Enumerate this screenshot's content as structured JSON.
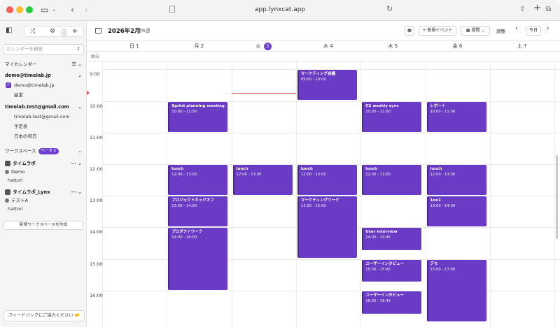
{
  "browser": {
    "url": "app.lynxcat.app"
  },
  "sidebar": {
    "search_placeholder": "カレンダーを検索",
    "my_calendars_label": "マイカレンダー",
    "accounts": [
      {
        "email": "demo@timelab.jp",
        "calendars": [
          "demo@timelab.jp",
          "副業"
        ]
      },
      {
        "email": "timelab.test@gmail.com",
        "calendars": [
          "timelab.test@gmail.com",
          "予定表",
          "日本の祝日"
        ]
      }
    ],
    "workspace_label": "ワークスペース",
    "workspace_badge": "ベータ",
    "workspace_badge_count": "2",
    "workspaces": [
      {
        "name": "タイムラボ",
        "members": [
          "Demo",
          "hattori"
        ]
      },
      {
        "name": "タイムラボ_Lynx",
        "members": [
          "テストA",
          "hattori"
        ]
      }
    ],
    "new_workspace_button": "新規ワークスペースを作成",
    "feedback_button": "フィードバックにご協力ください 🤝"
  },
  "toolbar": {
    "month": "2026年2月",
    "week": "第6週",
    "new_event": "新規イベント",
    "view": "週間",
    "adjust": "調整",
    "today": "今日"
  },
  "days": [
    {
      "name": "日",
      "num": "1",
      "today": false
    },
    {
      "name": "月",
      "num": "2",
      "today": false
    },
    {
      "name": "火",
      "num": "3",
      "today": true
    },
    {
      "name": "水",
      "num": "4",
      "today": false
    },
    {
      "name": "木",
      "num": "5",
      "today": false
    },
    {
      "name": "金",
      "num": "6",
      "today": false
    },
    {
      "name": "土",
      "num": "7",
      "today": false
    }
  ],
  "allday_label": "終日",
  "hours": [
    "9:00",
    "10:00",
    "11:00",
    "12:00",
    "13:00",
    "14:00",
    "15:00",
    "16:00"
  ],
  "events": [
    {
      "day": 3,
      "title": "マーケティング会議",
      "time": "09:00 - 10:00",
      "start": 9.0,
      "end": 10.0
    },
    {
      "day": 1,
      "title": "Sprint planning meeting",
      "time": "10:00 - 11:00",
      "start": 10.0,
      "end": 11.0
    },
    {
      "day": 4,
      "title": "CS weekly sync",
      "time": "10:00 - 11:00",
      "start": 10.0,
      "end": 11.0
    },
    {
      "day": 5,
      "title": "レポート",
      "time": "10:00 - 11:00",
      "start": 10.0,
      "end": 11.0
    },
    {
      "day": 1,
      "title": "lunch",
      "time": "12:00 - 13:00",
      "start": 12.0,
      "end": 13.0
    },
    {
      "day": 2,
      "title": "lunch",
      "time": "12:00 - 13:00",
      "start": 12.0,
      "end": 13.0
    },
    {
      "day": 3,
      "title": "lunch",
      "time": "12:00 - 13:00",
      "start": 12.0,
      "end": 13.0
    },
    {
      "day": 4,
      "title": "lunch",
      "time": "12:00 - 13:00",
      "start": 12.0,
      "end": 13.0
    },
    {
      "day": 5,
      "title": "lunch",
      "time": "12:00 - 13:00",
      "start": 12.0,
      "end": 13.0
    },
    {
      "day": 1,
      "title": "プロジェクトキックオフ",
      "time": "13:00 - 14:00",
      "start": 13.0,
      "end": 14.0
    },
    {
      "day": 3,
      "title": "マーケティングワーク",
      "time": "13:00 - 15:00",
      "start": 13.0,
      "end": 15.0
    },
    {
      "day": 5,
      "title": "1on1",
      "time": "13:00 - 14:00",
      "start": 13.0,
      "end": 14.0
    },
    {
      "day": 1,
      "title": "プロダクトワーク",
      "time": "14:00 - 16:00",
      "start": 14.0,
      "end": 16.0
    },
    {
      "day": 4,
      "title": "User interview",
      "time": "14:00 - 14:45",
      "start": 14.0,
      "end": 14.75
    },
    {
      "day": 4,
      "title": "ユーザーインタビュー",
      "time": "15:00 - 15:45",
      "start": 15.0,
      "end": 15.75
    },
    {
      "day": 5,
      "title": "デモ",
      "time": "15:00 - 17:00",
      "start": 15.0,
      "end": 17.0
    },
    {
      "day": 4,
      "title": "ユーザーインタビュー",
      "time": "16:00 - 16:45",
      "start": 16.0,
      "end": 16.75
    }
  ],
  "now_time": 9.75
}
